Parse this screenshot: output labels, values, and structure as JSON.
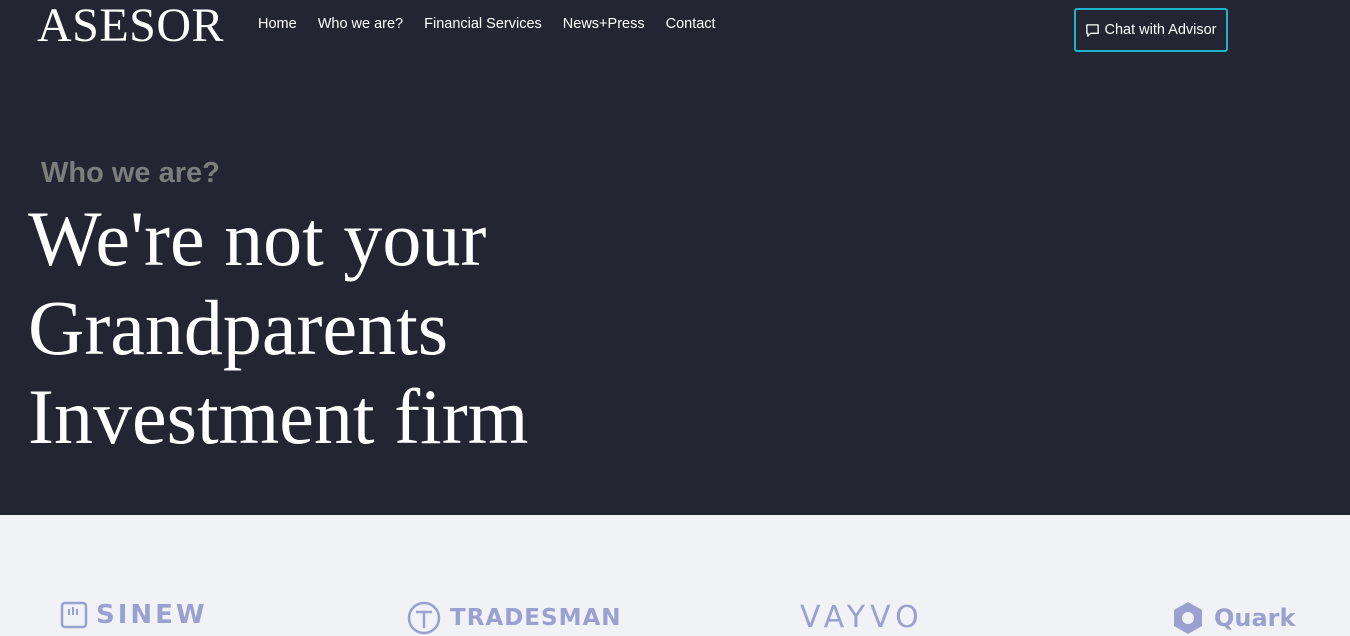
{
  "header": {
    "logo": "ASESOR",
    "nav": [
      "Home",
      "Who we are?",
      "Financial Services",
      "News+Press",
      "Contact"
    ],
    "chat_button": "Chat with Advisor",
    "chat_icon": "chat-bubble-icon",
    "accent_color": "#1fb2c9"
  },
  "hero": {
    "eyebrow": "Who we are?",
    "headline_lines": [
      "We're not your",
      "Grandparents",
      "Investment firm"
    ],
    "background": "#232532"
  },
  "partners": {
    "logos": [
      "SINEW",
      "TRADESMAN",
      "VAYVO",
      "Quark"
    ],
    "color": "#9aa0cf"
  }
}
